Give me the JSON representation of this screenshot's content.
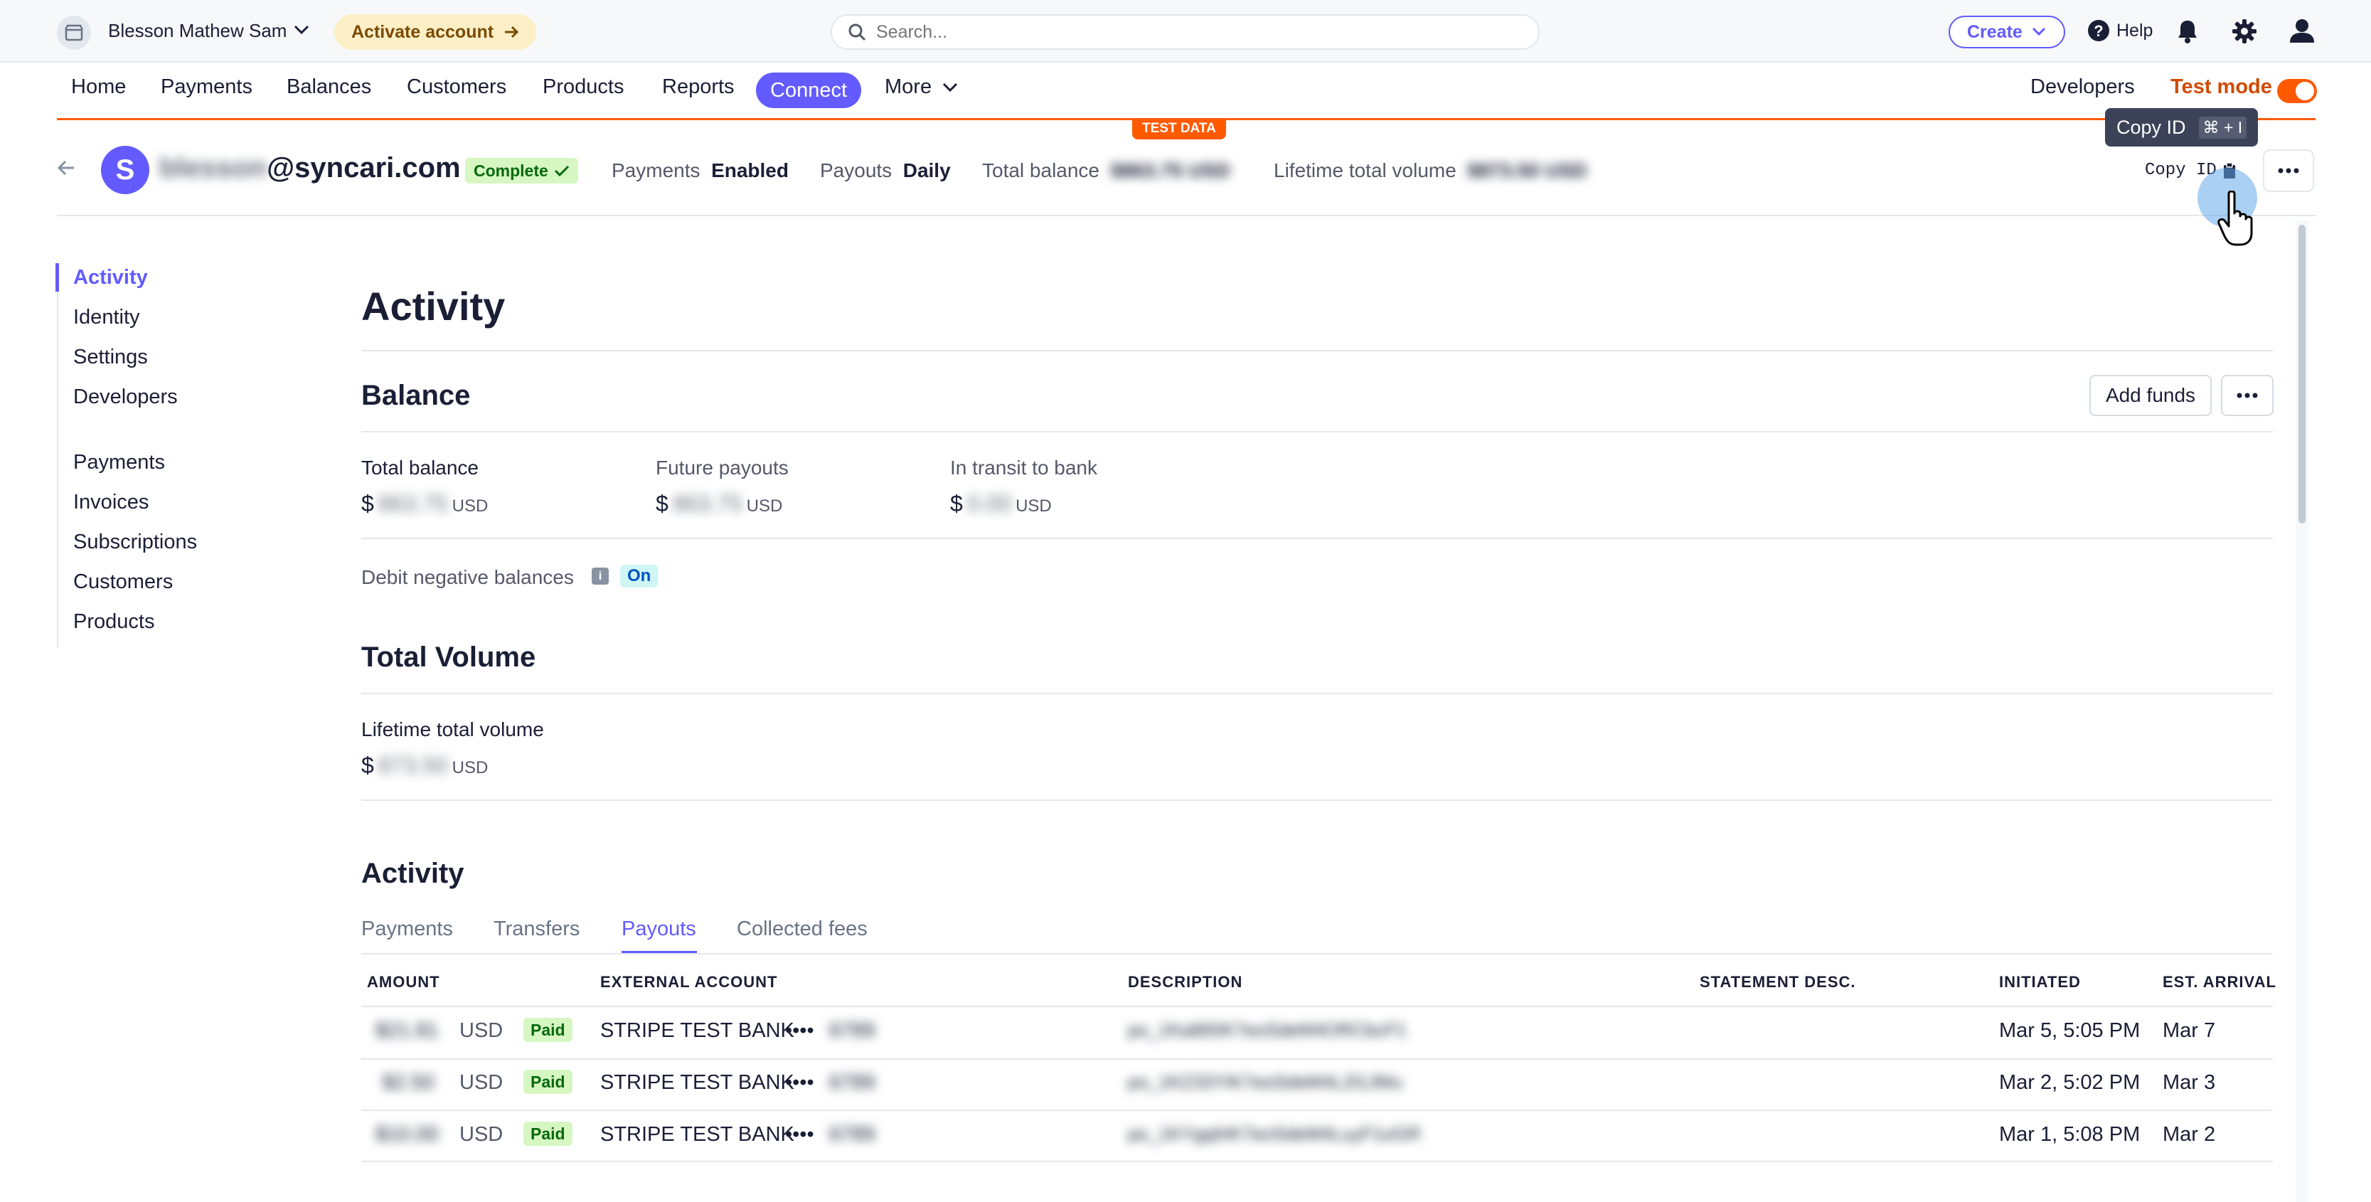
{
  "topbar": {
    "account_name": "Blesson Mathew Sam",
    "activate_label": "Activate account",
    "search_placeholder": "Search...",
    "create_label": "Create",
    "help_label": "Help"
  },
  "nav": {
    "items": [
      "Home",
      "Payments",
      "Balances",
      "Customers",
      "Products",
      "Reports",
      "Connect",
      "More"
    ],
    "developers": "Developers",
    "test_mode": "Test mode",
    "test_data_tag": "TEST DATA"
  },
  "account": {
    "avatar_letter": "S",
    "email_blurred": "blesson",
    "email_domain": "@syncari.com",
    "status": "Complete",
    "payments_label": "Payments",
    "payments_value": "Enabled",
    "payouts_label": "Payouts",
    "payouts_value": "Daily",
    "total_balance_label": "Total balance",
    "total_balance_value": "$863.75 USD",
    "lifetime_label": "Lifetime total volume",
    "lifetime_value": "$873.50 USD",
    "copy_id": "Copy ID",
    "tooltip_label": "Copy ID",
    "tooltip_keys": "⌘ + I"
  },
  "sidebar": {
    "group1": [
      "Activity",
      "Identity",
      "Settings",
      "Developers"
    ],
    "group2": [
      "Payments",
      "Invoices",
      "Subscriptions",
      "Customers",
      "Products"
    ]
  },
  "main": {
    "title": "Activity",
    "balance": {
      "heading": "Balance",
      "add_funds": "Add funds",
      "cols": [
        {
          "label": "Total balance",
          "value": "863.75",
          "currency": "USD"
        },
        {
          "label": "Future payouts",
          "value": "863.75",
          "currency": "USD"
        },
        {
          "label": "In transit to bank",
          "value": "0.00",
          "currency": "USD"
        }
      ],
      "debit_label": "Debit negative balances",
      "debit_status": "On"
    },
    "volume": {
      "heading": "Total Volume",
      "label": "Lifetime total volume",
      "value": "873.50",
      "currency": "USD"
    },
    "activity": {
      "heading": "Activity",
      "tabs": [
        "Payments",
        "Transfers",
        "Payouts",
        "Collected fees"
      ],
      "columns": [
        "AMOUNT",
        "EXTERNAL ACCOUNT",
        "DESCRIPTION",
        "STATEMENT DESC.",
        "INITIATED",
        "EST. ARRIVAL"
      ],
      "rows": [
        {
          "amount": "$21.81",
          "currency": "USD",
          "status": "Paid",
          "bank": "STRIPE TEST BANK",
          "dots": "••••",
          "last4": "6789",
          "description": "po_1Ka8t5IK7eoSdeM4ORCbcF1",
          "initiated": "Mar 5, 5:05 PM",
          "arrival": "Mar 7"
        },
        {
          "amount": "$2.50",
          "currency": "USD",
          "status": "Paid",
          "bank": "STRIPE TEST BANK",
          "dots": "••••",
          "last4": "6789",
          "description": "po_1KZ33YIK7eoSdeM4L2l1JMu",
          "initiated": "Mar 2, 5:02 PM",
          "arrival": "Mar 3"
        },
        {
          "amount": "$10.00",
          "currency": "USD",
          "status": "Paid",
          "bank": "STRIPE TEST BANK",
          "dots": "••••",
          "last4": "6789",
          "description": "po_1KYgqhIK7eoSdeM4LuyF1oGR",
          "initiated": "Mar 1, 5:08 PM",
          "arrival": "Mar 2"
        }
      ]
    }
  },
  "colors": {
    "accent": "#635bff",
    "test_mode": "#ff5a00",
    "paid_bg": "#d7f7c2"
  }
}
